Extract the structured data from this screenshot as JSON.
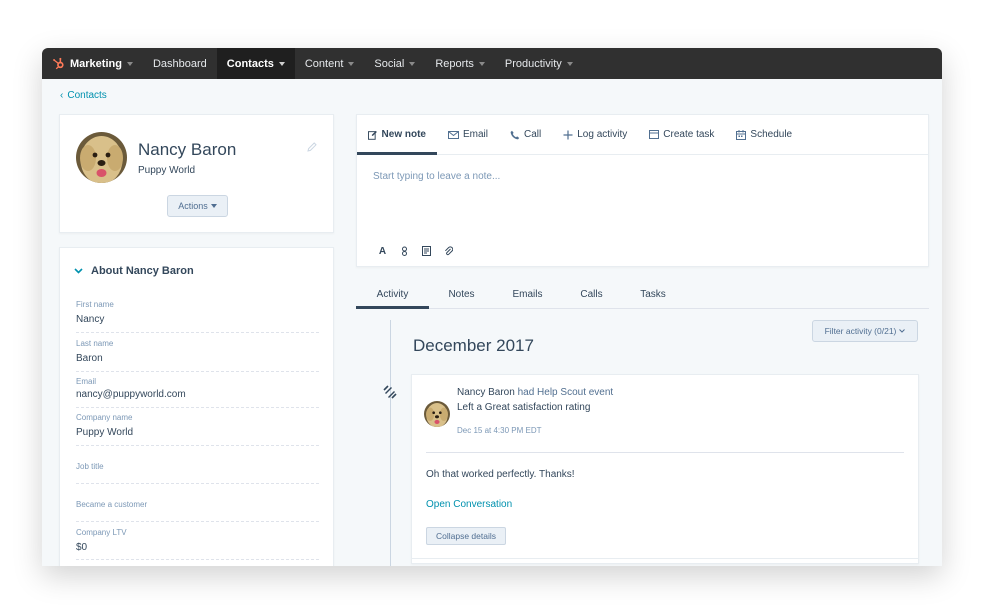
{
  "nav": {
    "brand": "Marketing",
    "items": [
      {
        "label": "Dashboard",
        "dropdown": false,
        "active": false
      },
      {
        "label": "Contacts",
        "dropdown": true,
        "active": true
      },
      {
        "label": "Content",
        "dropdown": true,
        "active": false
      },
      {
        "label": "Social",
        "dropdown": true,
        "active": false
      },
      {
        "label": "Reports",
        "dropdown": true,
        "active": false
      },
      {
        "label": "Productivity",
        "dropdown": true,
        "active": false
      }
    ],
    "brand_color": "#ff7a59"
  },
  "breadcrumb": {
    "chevron": "‹",
    "label": "Contacts"
  },
  "profile": {
    "name": "Nancy Baron",
    "company": "Puppy World",
    "actions_label": "Actions"
  },
  "about": {
    "title": "About Nancy Baron",
    "properties": [
      {
        "label": "First name",
        "value": "Nancy"
      },
      {
        "label": "Last name",
        "value": "Baron"
      },
      {
        "label": "Email",
        "value": "nancy@puppyworld.com"
      },
      {
        "label": "Company name",
        "value": "Puppy World"
      },
      {
        "label": "Job title",
        "value": ""
      },
      {
        "label": "Became a customer",
        "value": ""
      },
      {
        "label": "Company LTV",
        "value": "$0"
      }
    ]
  },
  "composer": {
    "tabs": [
      {
        "label": "New note",
        "icon": "edit-note-icon"
      },
      {
        "label": "Email",
        "icon": "envelope-icon"
      },
      {
        "label": "Call",
        "icon": "phone-icon"
      },
      {
        "label": "Log activity",
        "icon": "plus-icon"
      },
      {
        "label": "Create task",
        "icon": "task-icon"
      },
      {
        "label": "Schedule",
        "icon": "calendar-icon"
      }
    ],
    "placeholder": "Start typing to leave a note...",
    "format_bold": "A"
  },
  "activity_tabs": [
    {
      "label": "Activity",
      "active": true
    },
    {
      "label": "Notes",
      "active": false
    },
    {
      "label": "Emails",
      "active": false
    },
    {
      "label": "Calls",
      "active": false
    },
    {
      "label": "Tasks",
      "active": false
    }
  ],
  "timeline": {
    "filter_label": "Filter activity (0/21)",
    "month": "December 2017",
    "event": {
      "actor": "Nancy Baron",
      "action": " had Help Scout event",
      "detail": "Left a Great satisfaction rating",
      "time": "Dec 15 at 4:30 PM EDT",
      "body": "Oh that worked perfectly. Thanks!",
      "link": "Open Conversation",
      "collapse_label": "Collapse details"
    }
  },
  "colors": {
    "nav_bg": "#303030",
    "accent_link": "#0091ae",
    "text_primary": "#33475b",
    "text_muted": "#7c98b6",
    "button_bg": "#eaf0f6"
  }
}
